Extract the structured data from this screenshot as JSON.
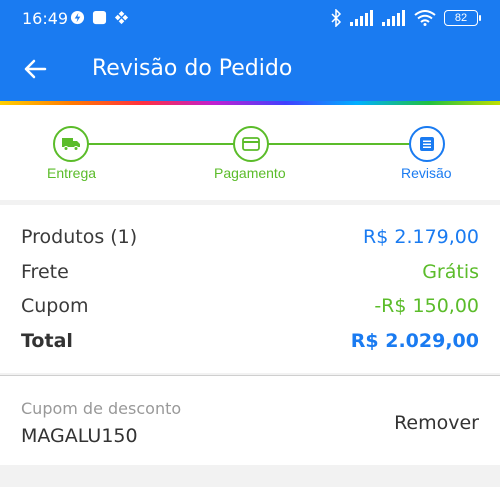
{
  "status_bar": {
    "time": "16:49",
    "battery": "82",
    "icons": [
      "flash-badge-icon",
      "app-icon",
      "puzzle-icon",
      "bluetooth-icon",
      "signal-icon",
      "signal-icon-2",
      "wifi-icon",
      "battery-icon"
    ]
  },
  "app_bar": {
    "title": "Revisão do Pedido",
    "back_icon": "arrow-left-icon"
  },
  "stepper": {
    "steps": [
      {
        "label": "Entrega",
        "icon": "truck-icon",
        "state": "done"
      },
      {
        "label": "Pagamento",
        "icon": "credit-card-icon",
        "state": "done"
      },
      {
        "label": "Revisão",
        "icon": "list-icon",
        "state": "current"
      }
    ],
    "colors": {
      "done": "#5bbc2a",
      "current": "#1a7bf1"
    }
  },
  "summary": {
    "products_label": "Produtos (1)",
    "products_value": "R$ 2.179,00",
    "shipping_label": "Frete",
    "shipping_value": "Grátis",
    "coupon_label": "Cupom",
    "coupon_value": "-R$ 150,00",
    "total_label": "Total",
    "total_value": "R$ 2.029,00"
  },
  "coupon": {
    "label": "Cupom de desconto",
    "code": "MAGALU150",
    "remove_label": "Remover"
  },
  "colors": {
    "primary": "#1a7bf1",
    "success": "#5bbc2a"
  }
}
